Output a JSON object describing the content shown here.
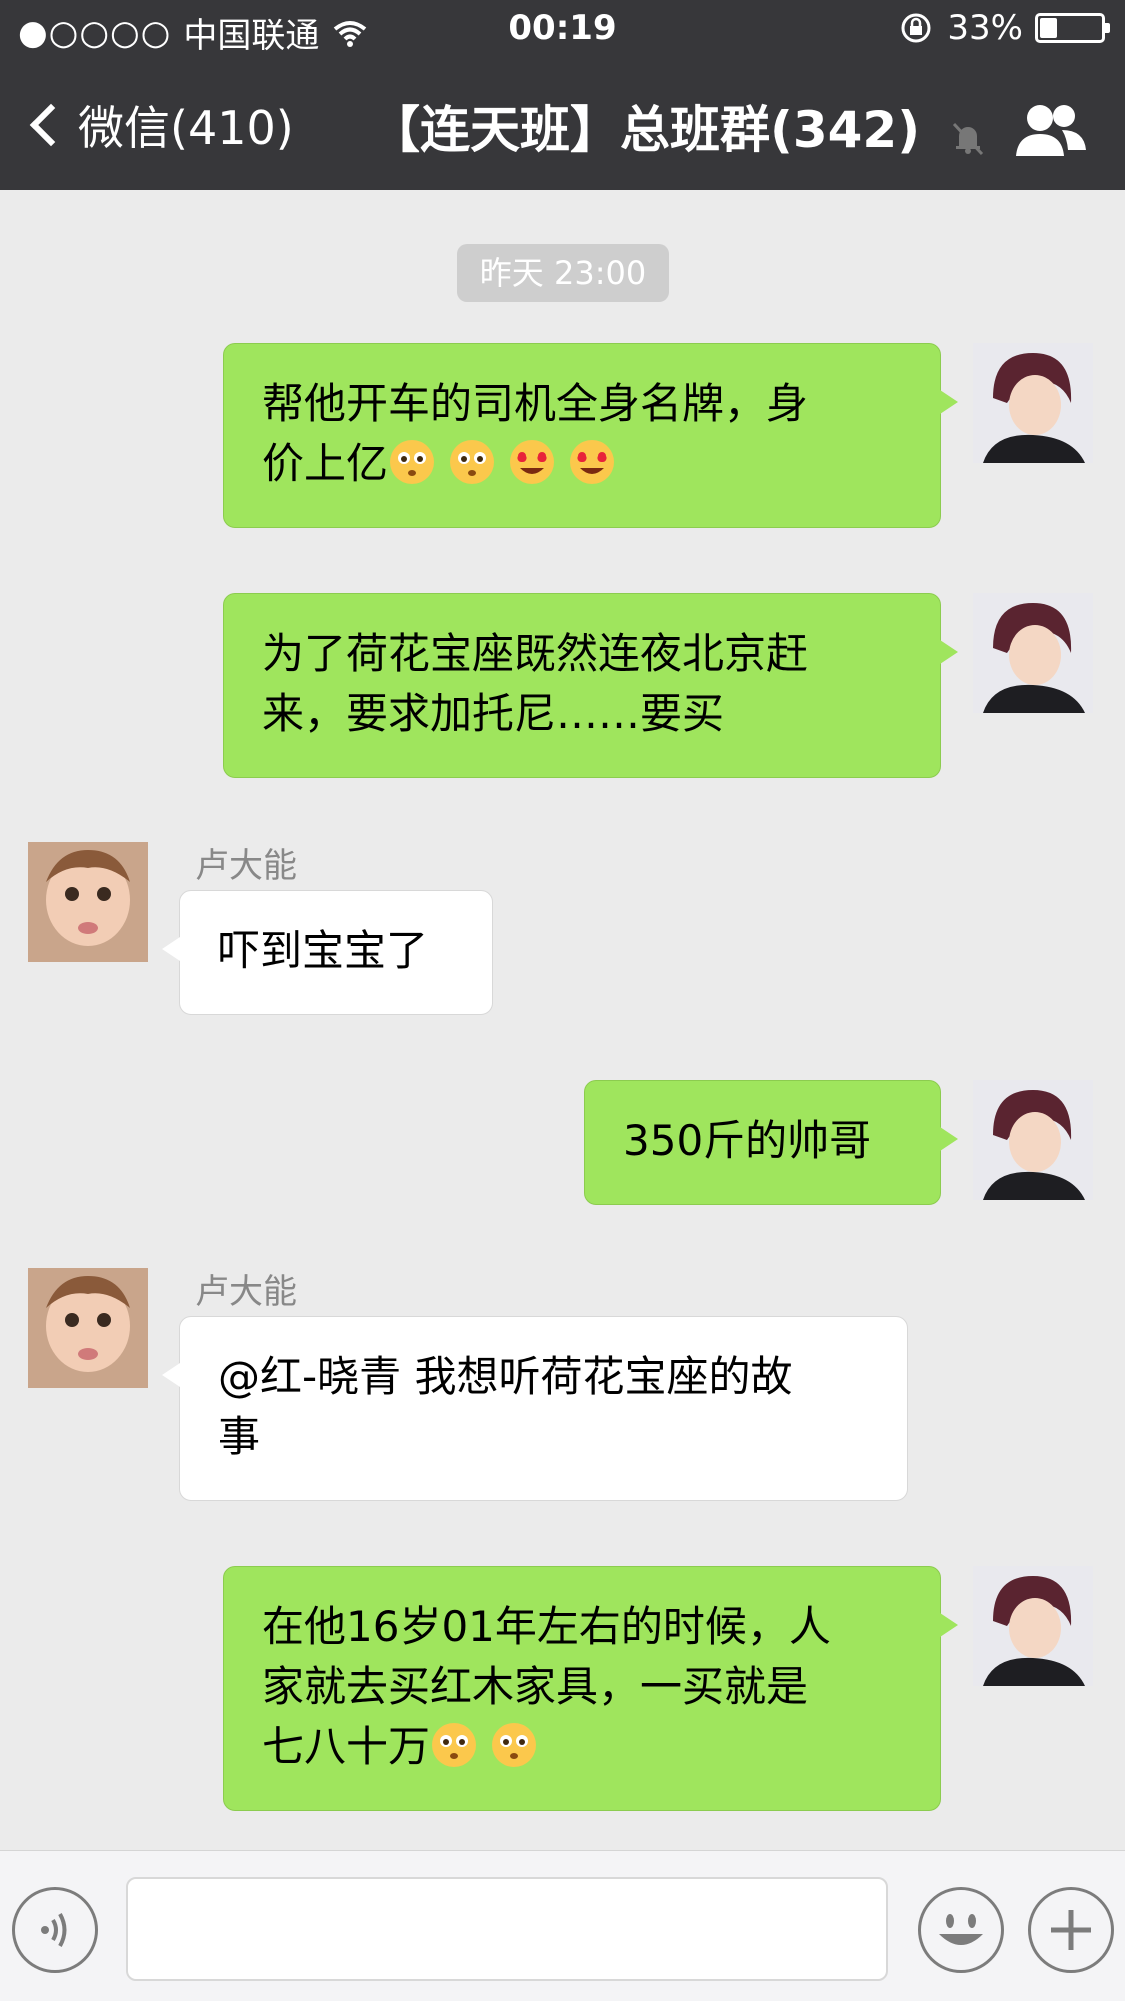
{
  "status_bar": {
    "signal": "●○○○○",
    "carrier": "中国联通",
    "time": "00:19",
    "battery_text": "33%",
    "battery_level": 0.33
  },
  "nav": {
    "back_label": "微信(410)",
    "title": "【连天班】总班群(342)"
  },
  "chat": {
    "timestamp": "昨天 23:00",
    "messages": [
      {
        "sender": "me",
        "line1": "帮他开车的司机全身名牌，身",
        "line2": "价上亿"
      },
      {
        "sender": "me",
        "line1": "为了荷花宝座既然连夜北京赶",
        "line2": "来，要求加托尼……要买"
      },
      {
        "sender": "卢大能",
        "name": "卢大能",
        "text": "吓到宝宝了"
      },
      {
        "sender": "me",
        "text": "350斤的帅哥"
      },
      {
        "sender": "卢大能",
        "name": "卢大能",
        "line1": "@红-晓青 我想听荷花宝座的故",
        "line2": "事"
      },
      {
        "sender": "me",
        "line1": "在他16岁01年左右的时候，人",
        "line2": "家就去买红木家具，一买就是",
        "line3": "七八十万"
      }
    ]
  },
  "colors": {
    "header_bg": "#37373a",
    "chat_bg": "#ebebeb",
    "my_bubble": "#9fe55d",
    "their_bubble": "#ffffff"
  },
  "icons": [
    "back-chevron-icon",
    "wifi-icon",
    "rotation-lock-icon",
    "battery-icon",
    "mute-bell-icon",
    "group-members-icon",
    "voice-icon",
    "emoji-icon",
    "plus-icon"
  ]
}
